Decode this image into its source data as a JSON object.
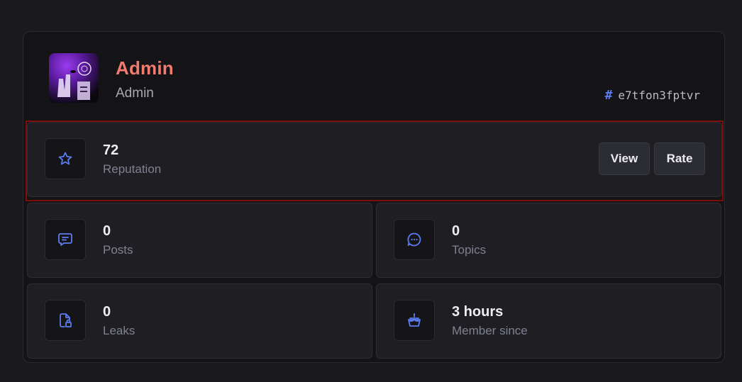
{
  "profile": {
    "username": "Admin",
    "role": "Admin",
    "uid": "e7tfon3fptvr",
    "username_color": "#f07b6e"
  },
  "reputation": {
    "value": "72",
    "label": "Reputation",
    "view_label": "View",
    "rate_label": "Rate",
    "icon": "star-icon"
  },
  "stats": [
    {
      "value": "0",
      "label": "Posts",
      "icon": "message-square-icon"
    },
    {
      "value": "0",
      "label": "Topics",
      "icon": "message-circle-icon"
    },
    {
      "value": "0",
      "label": "Leaks",
      "icon": "file-lock-icon"
    },
    {
      "value": "3 hours",
      "label": "Member since",
      "icon": "cake-icon"
    }
  ],
  "colors": {
    "accent": "#5b7cf0",
    "highlight_border": "#7e0e0e"
  }
}
